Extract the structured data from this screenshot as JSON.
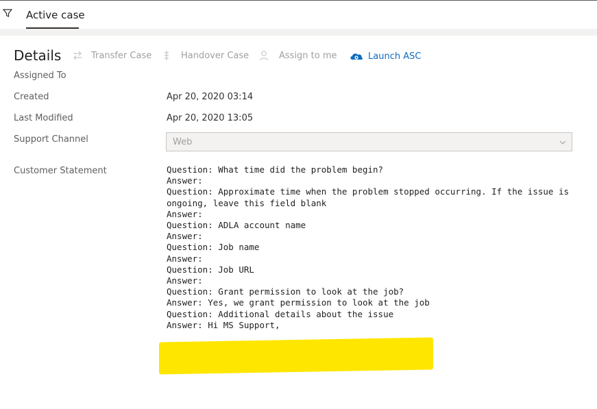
{
  "header": {
    "tab_label": "Active case"
  },
  "details": {
    "title": "Details",
    "commands": [
      {
        "label": "Transfer Case",
        "icon": "transfer-icon",
        "enabled": false
      },
      {
        "label": "Handover Case",
        "icon": "handover-icon",
        "enabled": false
      },
      {
        "label": "Assign to me",
        "icon": "person-icon",
        "enabled": false
      },
      {
        "label": "Launch ASC",
        "icon": "cloud-icon",
        "enabled": true
      }
    ],
    "fields": {
      "assigned_to": {
        "label": "Assigned To",
        "value": ""
      },
      "created": {
        "label": "Created",
        "value": "Apr 20, 2020 03:14"
      },
      "last_modified": {
        "label": "Last Modified",
        "value": "Apr 20, 2020 13:05"
      },
      "support_channel": {
        "label": "Support Channel",
        "value": "Web"
      },
      "customer_statement": {
        "label": "Customer Statement"
      }
    },
    "statement": [
      {
        "q": "Question: What time did the problem begin?",
        "a": "Answer:"
      },
      {
        "q": "Question: Approximate time when the problem stopped occurring. If the issue is ongoing, leave this field blank",
        "a": "Answer:"
      },
      {
        "q": "Question: ADLA account name",
        "a": "Answer:"
      },
      {
        "q": "Question: Job name",
        "a": "Answer:"
      },
      {
        "q": "Question: Job URL",
        "a": "Answer:"
      },
      {
        "q": "Question: Grant permission to look at the job?",
        "a": "Answer: Yes, we grant permission to look at the job"
      },
      {
        "q": "Question: Additional details about the issue",
        "a": "Answer: Hi MS Support,"
      }
    ]
  },
  "colors": {
    "accent": "#0f6cbd",
    "highlight": "#ffe600",
    "disabled_text": "#a19f9d"
  }
}
